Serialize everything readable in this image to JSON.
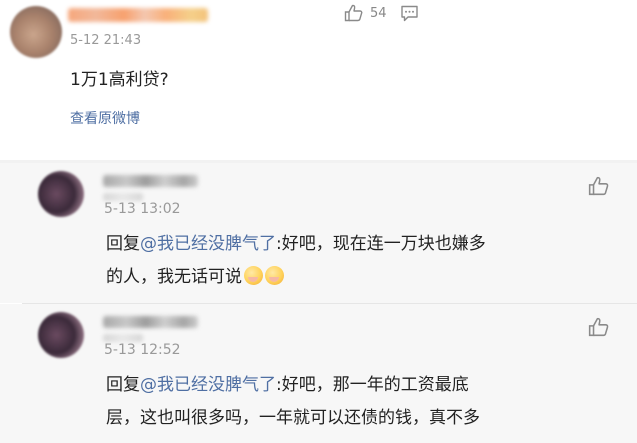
{
  "main_comment": {
    "time": "5-12 21:43",
    "likes": "54",
    "text": "1万1高利贷?",
    "view_original": "查看原微博"
  },
  "replies": [
    {
      "time": "5-13 13:02",
      "prefix": "回复",
      "mention": "@我已经没脾气了",
      "text_line1": ":好吧，现在连一万块也嫌多",
      "text_line2": "的人，我无话可说"
    },
    {
      "time": "5-13 12:52",
      "prefix": "回复",
      "mention": "@我已经没脾气了",
      "text_line1": ":好吧，那一年的工资最底",
      "text_line2": "层，这也叫很多吗，一年就可以还债的钱，真不多"
    }
  ],
  "icons": {
    "like": "thumbs-up-icon",
    "comment": "comment-icon",
    "emoji": "embarrassed-face-emoji"
  },
  "colors": {
    "link": "#4f6fa3",
    "reply_bg": "#f7f7f7"
  }
}
